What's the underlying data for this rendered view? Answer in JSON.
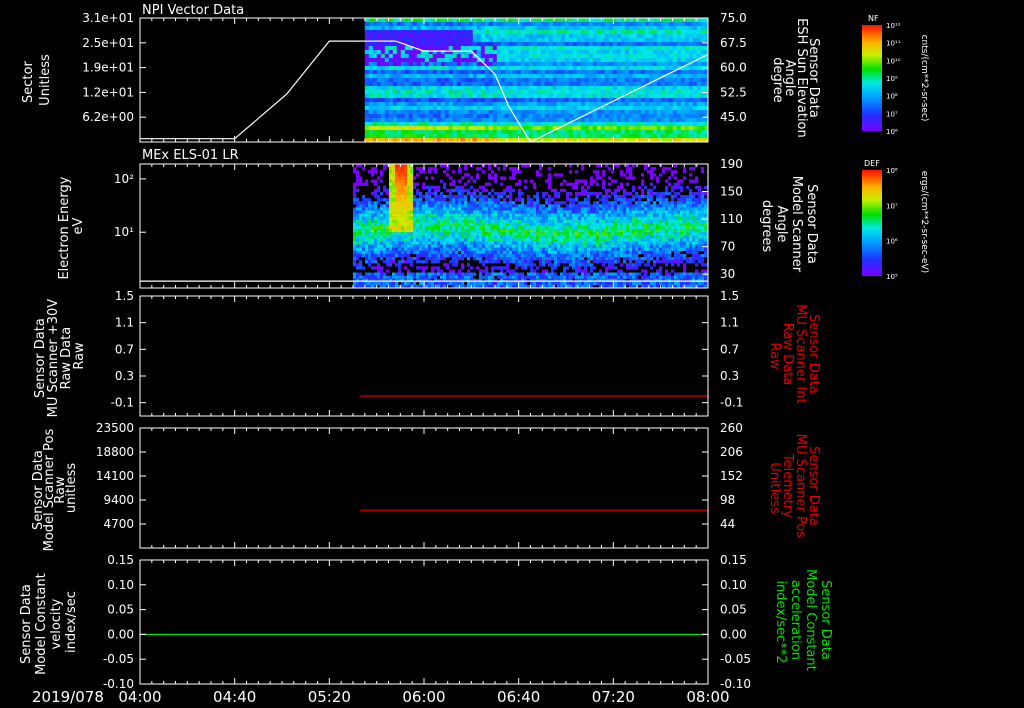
{
  "chart_data": [
    {
      "type": "heatmap",
      "title": "NPI Vector Data",
      "ylabel": "Sector\nUnitless",
      "yticks": [
        "3.1e+01",
        "2.5e+01",
        "1.9e+01",
        "1.2e+01",
        "6.2e+00"
      ],
      "y2label": "Sensor Data\nESH Sun Elevation\nAngle\ndegree",
      "y2ticks": [
        "75.0",
        "67.5",
        "60.0",
        "52.5",
        "45.0"
      ],
      "y2lim": [
        37.5,
        75
      ],
      "data_start": "05:35",
      "line_series": {
        "x": [
          "04:00",
          "04:40",
          "05:02",
          "05:20",
          "05:30",
          "05:48",
          "06:00",
          "06:20",
          "06:30",
          "06:36",
          "06:45",
          "08:00"
        ],
        "y": [
          38.5,
          38.5,
          52,
          68,
          68,
          68,
          65,
          65,
          58,
          48,
          37.5,
          64
        ]
      },
      "colorbar": {
        "label": "NF",
        "units": "cnts/(cm**2-sr-sec)",
        "ticks": [
          "10¹²",
          "10¹¹",
          "10¹⁰",
          "10⁹",
          "10⁸",
          "10⁷",
          "10⁶"
        ]
      }
    },
    {
      "type": "heatmap",
      "title": "MEx ELS-01 LR",
      "ylabel": "Electron Energy\neV",
      "yticks": [
        "10²",
        "10¹"
      ],
      "y2label": "Sensor Data\nModel Scanner\nAngle\ndegrees",
      "y2ticks": [
        "190",
        "150",
        "110",
        "70",
        "30"
      ],
      "y2lim": [
        10,
        190
      ],
      "data_start": "05:30",
      "burst_time": "05:50",
      "baseline_value": 20,
      "colorbar": {
        "label": "DEF",
        "units": "ergs/(cm**2-sr-sec-eV)",
        "ticks": [
          "10⁸",
          "10⁷",
          "10⁶",
          "10⁵"
        ]
      }
    },
    {
      "type": "line",
      "ylabel": "Sensor Data\nMU Scanner +30V\nRaw Data\nRaw",
      "yticks": [
        "1.5",
        "1.1",
        "0.7",
        "0.3",
        "-0.1"
      ],
      "ylim": [
        -0.3,
        1.5
      ],
      "y2label": "Sensor Data\nMU Scanner Int\nRaw Data\nRaw",
      "y2ticks": [
        "1.5",
        "1.1",
        "0.7",
        "0.3",
        "-0.1"
      ],
      "series": [
        {
          "color": "#e00000",
          "x": [
            "05:33",
            "08:00"
          ],
          "y": [
            0,
            0
          ]
        }
      ]
    },
    {
      "type": "line",
      "ylabel": "Sensor Data\nModel Scanner Pos\nRaw\nunitless",
      "yticks": [
        "23500",
        "18800",
        "14100",
        "9400",
        "4700"
      ],
      "ylim": [
        0,
        23500
      ],
      "y2label": "Sensor Data\nMU Scanner Pos\nTelemetry\nUnitless",
      "y2ticks": [
        "260",
        "206",
        "152",
        "98",
        "44"
      ],
      "series": [
        {
          "color": "#e00000",
          "x": [
            "05:33",
            "08:00"
          ],
          "y": [
            7400,
            7400
          ]
        }
      ]
    },
    {
      "type": "line",
      "ylabel": "Sensor Data\nModel Constant\nvelocity\nindex/sec",
      "yticks": [
        "0.15",
        "0.10",
        "0.05",
        "0.00",
        "-0.05",
        "-0.10"
      ],
      "ylim": [
        -0.1,
        0.15
      ],
      "y2label": "Sensor Data\nModel Constant\nacceleration\nindex/sec**2",
      "y2ticks": [
        "0.15",
        "0.10",
        "0.05",
        "0.00",
        "-0.05",
        "-0.10"
      ],
      "series": [
        {
          "color": "#00e000",
          "x": [
            "04:00",
            "08:00"
          ],
          "y": [
            0,
            0
          ]
        }
      ]
    }
  ],
  "time_axis": {
    "date": "2019/078",
    "labels": [
      "04:00",
      "04:40",
      "05:20",
      "06:00",
      "06:40",
      "07:20",
      "08:00"
    ]
  },
  "colors": {
    "red": "#e00000",
    "green": "#00e000",
    "background": "#000000",
    "foreground": "#ffffff"
  }
}
